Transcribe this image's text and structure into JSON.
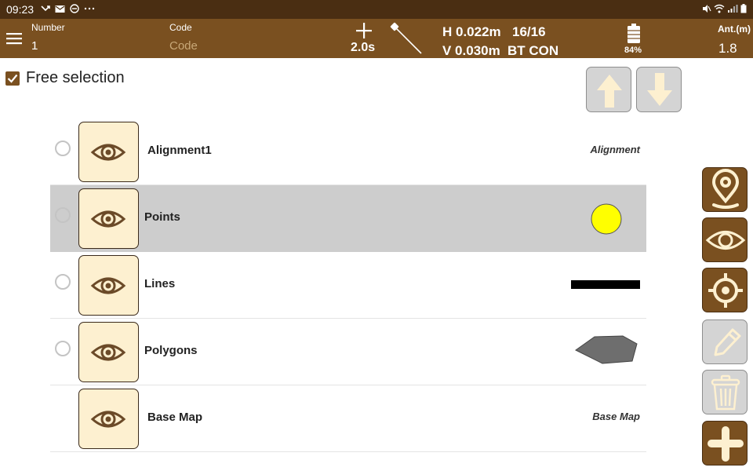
{
  "status_bar": {
    "time": "09:23",
    "left_icons": [
      "missed-call-icon",
      "mail-icon",
      "do-not-disturb-icon",
      "more-icon"
    ],
    "right_icons": [
      "mute-icon",
      "wifi-icon",
      "signal-icon",
      "battery-icon"
    ]
  },
  "app_bar": {
    "number_label": "Number",
    "number_value": "1",
    "code_label": "Code",
    "code_placeholder": "Code",
    "interval": "2.0s",
    "h_precision": "H 0.022m",
    "v_precision": "V 0.030m",
    "satellites": "16/16",
    "connection": "BT CON",
    "battery_percent": "84%",
    "antenna_label": "Ant.(m)",
    "antenna_value": "1.8"
  },
  "free_selection": {
    "label": "Free selection",
    "checked": true
  },
  "layers": [
    {
      "name": "Alignment1",
      "type_label": "Alignment",
      "symbol": "text",
      "has_radio": true,
      "selected": false
    },
    {
      "name": "Points",
      "type_label": "",
      "symbol": "point",
      "has_radio": true,
      "selected": true
    },
    {
      "name": "Lines",
      "type_label": "",
      "symbol": "line",
      "has_radio": true,
      "selected": false
    },
    {
      "name": "Polygons",
      "type_label": "",
      "symbol": "polygon",
      "has_radio": true,
      "selected": false
    },
    {
      "name": "Base Map",
      "type_label": "Base Map",
      "symbol": "text",
      "has_radio": false,
      "selected": false
    }
  ],
  "tools": [
    {
      "name": "location-pin-button",
      "icon": "location-pin-icon",
      "enabled": true
    },
    {
      "name": "view-button",
      "icon": "eye-icon",
      "enabled": true
    },
    {
      "name": "target-button",
      "icon": "crosshair-icon",
      "enabled": true
    },
    {
      "name": "edit-button",
      "icon": "pencil-icon",
      "enabled": false
    },
    {
      "name": "delete-button",
      "icon": "trash-icon",
      "enabled": false
    },
    {
      "name": "add-button",
      "icon": "plus-icon",
      "enabled": true
    }
  ],
  "colors": {
    "status_bar": "#4a2e12",
    "app_bar": "#7a5020",
    "accent": "#7a5020",
    "eye_button_bg": "#fdf0d0",
    "selected_row": "#cdcdcd",
    "point_symbol": "#ffff00",
    "polygon_symbol": "#6e6e6e",
    "disabled_button": "#d4d4d4",
    "disabled_icon": "#fdf0d0"
  }
}
